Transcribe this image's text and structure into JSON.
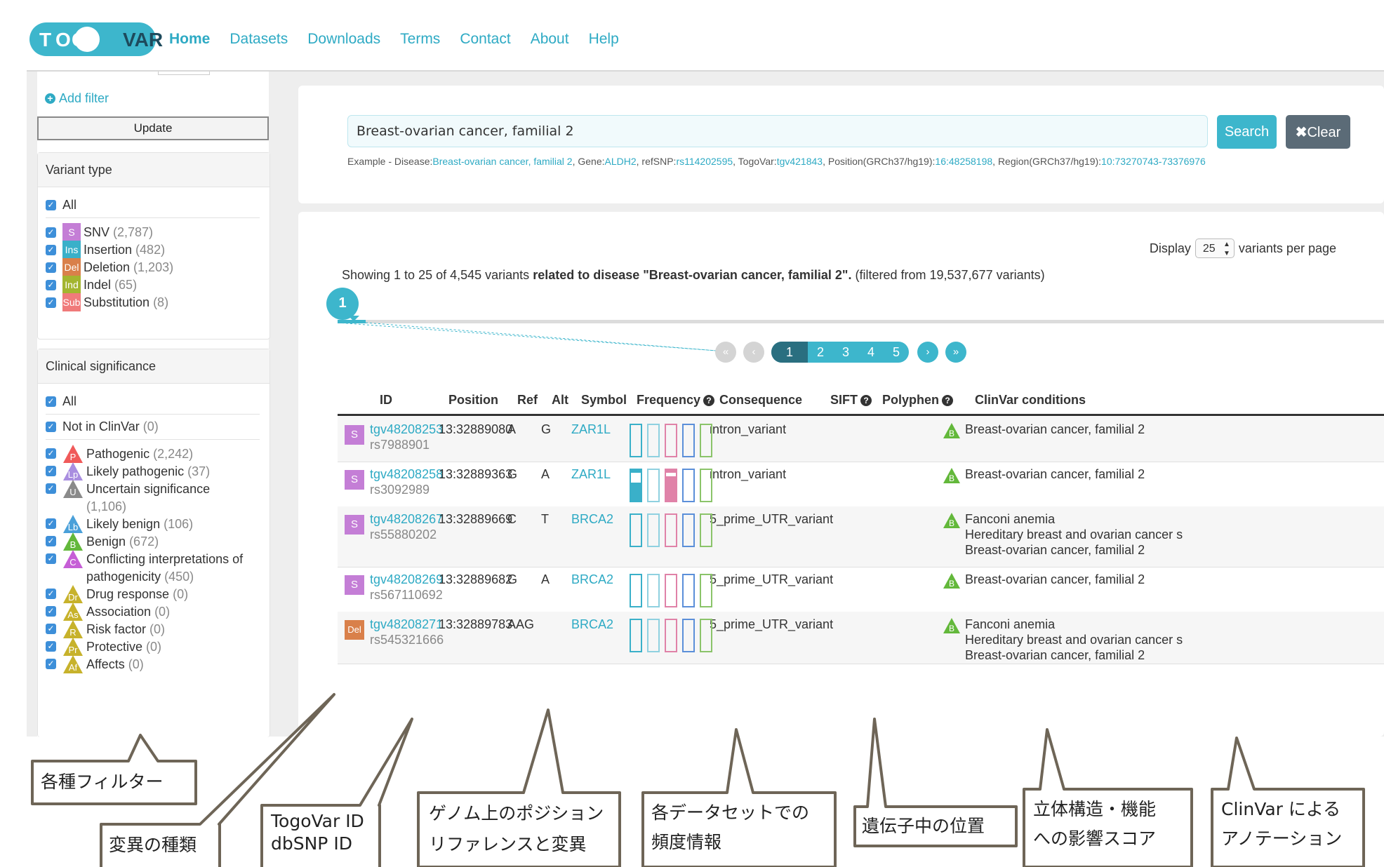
{
  "nav": {
    "logo_text": "TOGOVAR",
    "items": [
      "Home",
      "Datasets",
      "Downloads",
      "Terms",
      "Contact",
      "About",
      "Help"
    ]
  },
  "sidebar": {
    "add_filter": "Add filter",
    "update": "Update",
    "variant_type": {
      "title": "Variant type",
      "all": "All",
      "items": [
        {
          "abbr": "S",
          "label": "SNV",
          "count": "(2,787)",
          "color": "#c47ed6"
        },
        {
          "abbr": "Ins",
          "label": "Insertion",
          "count": "(482)",
          "color": "#3ab0c9"
        },
        {
          "abbr": "Del",
          "label": "Deletion",
          "count": "(1,203)",
          "color": "#d9804a"
        },
        {
          "abbr": "Ind",
          "label": "Indel",
          "count": "(65)",
          "color": "#a3b52f"
        },
        {
          "abbr": "Sub",
          "label": "Substitution",
          "count": "(8)",
          "color": "#f07a7a"
        }
      ]
    },
    "clinical": {
      "title": "Clinical significance",
      "all": "All",
      "not_in": {
        "label": "Not in ClinVar",
        "count": "(0)"
      },
      "items": [
        {
          "abbr": "P",
          "label": "Pathogenic",
          "count": "(2,242)",
          "color": "#f05a5a"
        },
        {
          "abbr": "Lp",
          "label": "Likely pathogenic",
          "count": "(37)",
          "color": "#a98ee0"
        },
        {
          "abbr": "U",
          "label": "Uncertain significance",
          "label2": "",
          "count": "(1,106)",
          "color": "#8a8a8a"
        },
        {
          "abbr": "Lb",
          "label": "Likely benign",
          "count": "(106)",
          "color": "#4aa0d9"
        },
        {
          "abbr": "B",
          "label": "Benign",
          "count": "(672)",
          "color": "#63b83b"
        },
        {
          "abbr": "C",
          "label": "Conflicting interpretations of",
          "label2": "pathogenicity",
          "count": "(450)",
          "color": "#c65fd6"
        },
        {
          "abbr": "Dr",
          "label": "Drug response",
          "count": "(0)",
          "color": "#c7b22b"
        },
        {
          "abbr": "As",
          "label": "Association",
          "count": "(0)",
          "color": "#c7b22b"
        },
        {
          "abbr": "R",
          "label": "Risk factor",
          "count": "(0)",
          "color": "#c7b22b"
        },
        {
          "abbr": "Pr",
          "label": "Protective",
          "count": "(0)",
          "color": "#c7b22b"
        },
        {
          "abbr": "Af",
          "label": "Affects",
          "count": "(0)",
          "color": "#c7b22b"
        }
      ]
    }
  },
  "search": {
    "value": "Breast-ovarian cancer, familial 2",
    "button": "Search",
    "clear": "Clear",
    "example": {
      "prefix": "Example - Disease:",
      "disease": "Breast-ovarian cancer, familial 2",
      "gene_label": ", Gene:",
      "gene": "ALDH2",
      "refsnp_label": ", refSNP:",
      "refsnp": "rs114202595",
      "togovar_label": ", TogoVar:",
      "togovar": "tgv421843",
      "position_label": ", Position(GRCh37/hg19):",
      "position": "16:48258198",
      "region_label": ", Region(GRCh37/hg19):",
      "region": "10:73270743-73376976"
    }
  },
  "results": {
    "display_label": "Display",
    "per_page": "25",
    "per_page_suffix": "variants per page",
    "showing_pre": "Showing 1 to 25 of 4,545 variants ",
    "showing_bold": "related to disease \"Breast-ovarian cancer, familial 2\".",
    "showing_post": " (filtered from 19,537,677 variants)",
    "current_page_bubble": "1",
    "pager": {
      "first": "«",
      "prev": "‹",
      "next": "›",
      "last": "»",
      "pages": [
        "1",
        "2",
        "3",
        "4",
        "5"
      ]
    },
    "columns": [
      "ID",
      "Position",
      "Ref",
      "Alt",
      "Symbol",
      "Frequency",
      "Consequence",
      "SIFT",
      "Polyphen",
      "ClinVar conditions"
    ],
    "frequency_colors": [
      "#3ab0c9",
      "#8fd1e0",
      "#e082a8",
      "#5b8fd9",
      "#8bc46a"
    ],
    "rows": [
      {
        "type": "S",
        "type_color": "#c47ed6",
        "id": "tgv48208253",
        "rs": "rs7988901",
        "position": "13:32889080",
        "ref": "A",
        "alt": "G",
        "symbol": "ZAR1L",
        "freq": [
          0,
          0,
          0,
          0,
          0
        ],
        "consequence": "intron_variant",
        "clinvar": [
          {
            "sig": "B",
            "color": "#63b83b",
            "conditions": [
              "Breast-ovarian cancer, familial 2"
            ]
          }
        ]
      },
      {
        "type": "S",
        "type_color": "#c47ed6",
        "id": "tgv48208258",
        "rs": "rs3092989",
        "position": "13:32889363",
        "ref": "G",
        "alt": "A",
        "symbol": "ZAR1L",
        "freq": [
          0.6,
          0,
          0.8,
          0,
          0
        ],
        "consequence": "intron_variant",
        "clinvar": [
          {
            "sig": "B",
            "color": "#63b83b",
            "conditions": [
              "Breast-ovarian cancer, familial 2"
            ]
          }
        ]
      },
      {
        "type": "S",
        "type_color": "#c47ed6",
        "id": "tgv48208267",
        "rs": "rs55880202",
        "position": "13:32889669",
        "ref": "C",
        "alt": "T",
        "symbol": "BRCA2",
        "freq": [
          0,
          0,
          0,
          0,
          0
        ],
        "consequence": "5_prime_UTR_variant",
        "clinvar": [
          {
            "sig": "B",
            "color": "#63b83b",
            "conditions": [
              "Fanconi anemia",
              "Hereditary breast and ovarian cancer s",
              "Breast-ovarian cancer, familial 2"
            ]
          }
        ]
      },
      {
        "type": "S",
        "type_color": "#c47ed6",
        "id": "tgv48208269",
        "rs": "rs567110692",
        "position": "13:32889682",
        "ref": "G",
        "alt": "A",
        "symbol": "BRCA2",
        "freq": [
          0,
          0,
          0,
          0,
          0
        ],
        "consequence": "5_prime_UTR_variant",
        "clinvar": [
          {
            "sig": "B",
            "color": "#63b83b",
            "conditions": [
              "Breast-ovarian cancer, familial 2"
            ]
          }
        ]
      },
      {
        "type": "Del",
        "type_color": "#d9804a",
        "id": "tgv48208271",
        "rs": "rs545321666",
        "position": "13:32889783",
        "ref": "AAG",
        "alt": "",
        "symbol": "BRCA2",
        "freq": [
          0,
          0,
          0,
          0,
          0
        ],
        "consequence": "5_prime_UTR_variant",
        "clinvar": [
          {
            "sig": "B",
            "color": "#63b83b",
            "conditions": [
              "Fanconi anemia",
              "Hereditary breast and ovarian cancer s",
              "Breast-ovarian cancer, familial 2"
            ]
          }
        ]
      }
    ]
  },
  "annotations": [
    {
      "name": "filters",
      "lines": [
        "各種フィルター"
      ]
    },
    {
      "name": "variant-type",
      "lines": [
        "変異の種類"
      ]
    },
    {
      "name": "ids",
      "lines": [
        "TogoVar ID",
        "dbSNP ID"
      ]
    },
    {
      "name": "position",
      "lines": [
        "ゲノム上のポジション",
        "リファレンスと変異"
      ]
    },
    {
      "name": "frequency",
      "lines": [
        "各データセットでの",
        "頻度情報"
      ]
    },
    {
      "name": "consequence",
      "lines": [
        "遺伝子中の位置"
      ]
    },
    {
      "name": "scores",
      "lines": [
        "立体構造・機能",
        "への影響スコア"
      ]
    },
    {
      "name": "clinvar",
      "lines": [
        "ClinVar による",
        "アノテーション"
      ]
    }
  ]
}
